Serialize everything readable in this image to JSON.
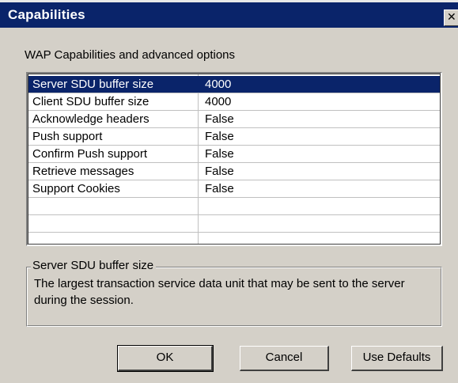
{
  "window": {
    "title": "Capabilities",
    "close_glyph": "✕"
  },
  "group_label": "WAP Capabilities and advanced options",
  "grid": {
    "rows": [
      {
        "name": "Server SDU buffer size",
        "value": "4000",
        "selected": true
      },
      {
        "name": "Client SDU buffer size",
        "value": "4000",
        "selected": false
      },
      {
        "name": "Acknowledge headers",
        "value": "False",
        "selected": false
      },
      {
        "name": "Push support",
        "value": "False",
        "selected": false
      },
      {
        "name": "Confirm Push support",
        "value": "False",
        "selected": false
      },
      {
        "name": "Retrieve messages",
        "value": "False",
        "selected": false
      },
      {
        "name": "Support Cookies",
        "value": "False",
        "selected": false
      },
      {
        "name": "",
        "value": "",
        "selected": false
      },
      {
        "name": "",
        "value": "",
        "selected": false
      },
      {
        "name": "",
        "value": "",
        "selected": false
      }
    ]
  },
  "description": {
    "title": "Server SDU buffer size",
    "text": "The largest transaction service data unit that may be sent to the server during the session."
  },
  "buttons": {
    "ok": "OK",
    "cancel": "Cancel",
    "defaults": "Use Defaults"
  },
  "colors": {
    "titlebar": "#0a246a",
    "face": "#d4d0c8",
    "selection": "#0a246a"
  }
}
